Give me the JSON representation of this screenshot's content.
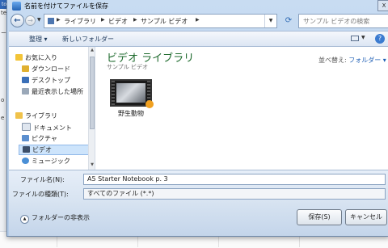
{
  "background": {
    "tab_label": "tolet",
    "snippets": [
      "ter N",
      "ード",
      "o",
      "e"
    ]
  },
  "dialog": {
    "title": "名前を付けてファイルを保存",
    "close_label": "X"
  },
  "nav": {
    "back_icon": "back-arrow-icon",
    "forward_icon": "forward-arrow-icon",
    "breadcrumbs": [
      "ライブラリ",
      "ビデオ",
      "サンプル ビデオ"
    ],
    "search_placeholder": "サンプル ビデオの検索"
  },
  "toolbar": {
    "organize": "整理 ▾",
    "new_folder": "新しいフォルダー",
    "help": "?"
  },
  "sidebar": {
    "favorites_header": "お気に入り",
    "favorites": [
      "ダウンロード",
      "デスクトップ",
      "最近表示した場所"
    ],
    "libraries_header": "ライブラリ",
    "libraries": [
      "ドキュメント",
      "ピクチャ",
      "ビデオ",
      "ミュージック"
    ],
    "selected": "ビデオ"
  },
  "content": {
    "library_title": "ビデオ ライブラリ",
    "library_subtitle": "サンプル ビデオ",
    "sort_label": "並べ替え:",
    "sort_value": "フォルダー ▾",
    "files": [
      {
        "name": "野生動物"
      }
    ]
  },
  "fields": {
    "filename_label": "ファイル名(N):",
    "filename_value": "A5 Starter Notebook p. 3",
    "filetype_label": "ファイルの種類(T):",
    "filetype_value": "すべてのファイル (*.*)"
  },
  "footer": {
    "hide_folders": "フォルダーの非表示",
    "save_button": "保存(S)",
    "cancel_button": "キャンセル"
  }
}
